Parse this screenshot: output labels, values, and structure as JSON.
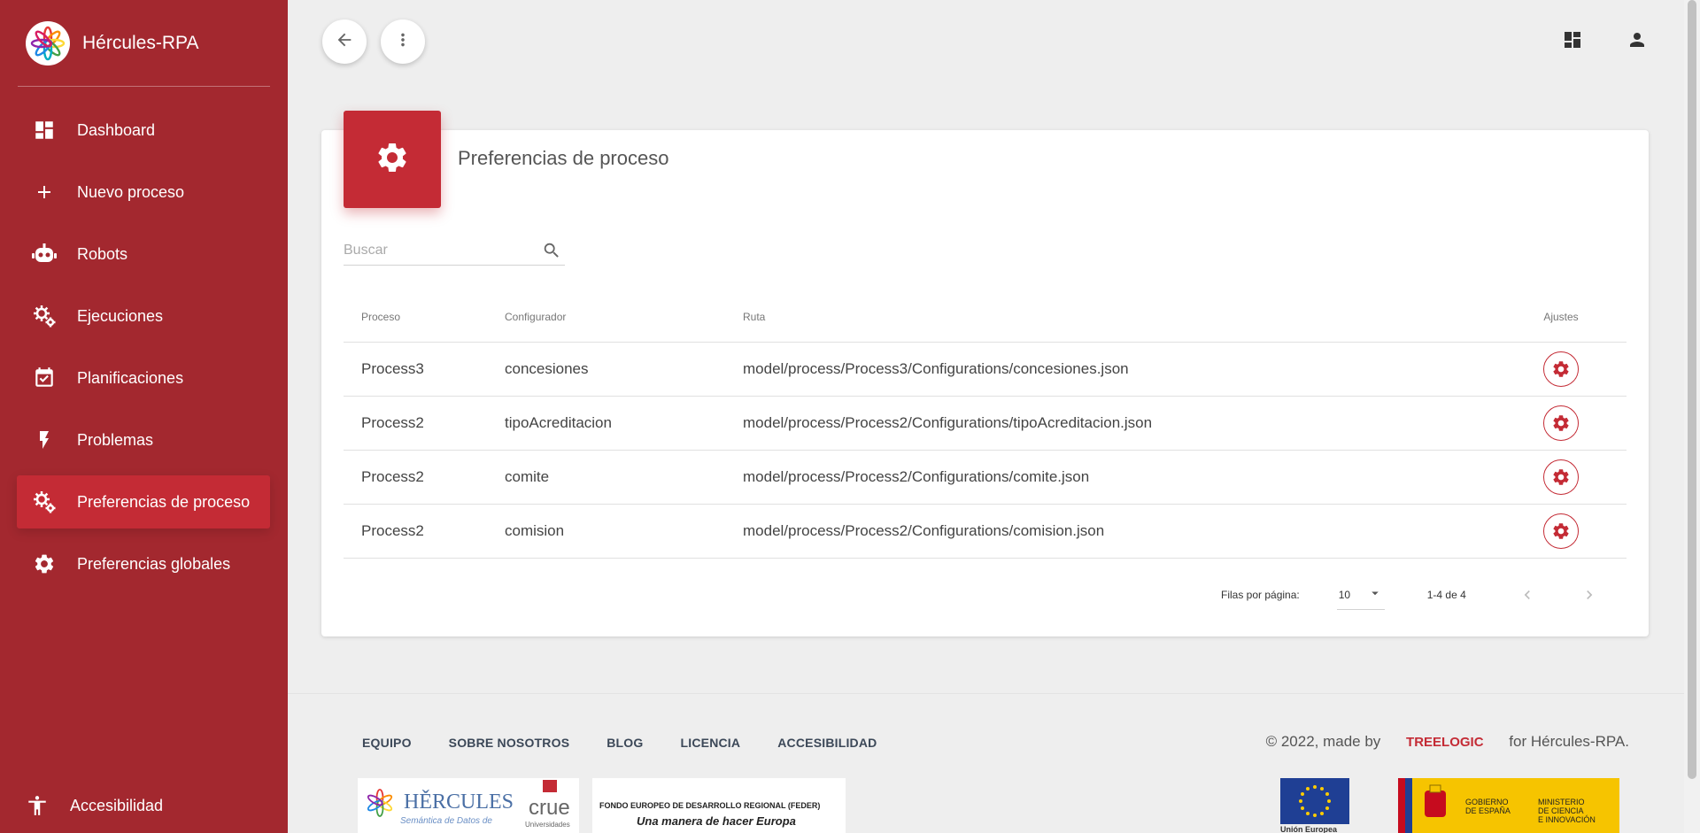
{
  "app": {
    "name": "Hércules-RPA"
  },
  "sidebar": {
    "items": [
      {
        "label": "Dashboard",
        "icon": "dashboard-icon"
      },
      {
        "label": "Nuevo proceso",
        "icon": "plus-icon"
      },
      {
        "label": "Robots",
        "icon": "robot-icon"
      },
      {
        "label": "Ejecuciones",
        "icon": "gears-icon"
      },
      {
        "label": "Planificaciones",
        "icon": "calendar-icon"
      },
      {
        "label": "Problemas",
        "icon": "bolt-icon"
      },
      {
        "label": "Preferencias de proceso",
        "icon": "gears-icon",
        "active": true
      },
      {
        "label": "Preferencias globales",
        "icon": "gear-icon"
      }
    ],
    "accessibility_label": "Accesibilidad"
  },
  "page": {
    "title": "Preferencias de proceso",
    "search_placeholder": "Buscar"
  },
  "table": {
    "headers": [
      "Proceso",
      "Configurador",
      "Ruta",
      "Ajustes"
    ],
    "rows": [
      {
        "proceso": "Process3",
        "configurador": "concesiones",
        "ruta": "model/process/Process3/Configurations/concesiones.json"
      },
      {
        "proceso": "Process2",
        "configurador": "tipoAcreditacion",
        "ruta": "model/process/Process2/Configurations/tipoAcreditacion.json"
      },
      {
        "proceso": "Process2",
        "configurador": "comite",
        "ruta": "model/process/Process2/Configurations/comite.json"
      },
      {
        "proceso": "Process2",
        "configurador": "comision",
        "ruta": "model/process/Process2/Configurations/comision.json"
      }
    ]
  },
  "pagination": {
    "rows_label": "Filas por página:",
    "rows_value": "10",
    "range": "1-4 de 4"
  },
  "footer": {
    "links": [
      "EQUIPO",
      "SOBRE NOSOTROS",
      "BLOG",
      "LICENCIA",
      "ACCESIBILIDAD"
    ],
    "copyright_prefix": "© 2022, made by",
    "company": "TREELOGIC",
    "copyright_suffix": "for Hércules-RPA.",
    "hercules_logo": "HĚRCULES",
    "hercules_sub": "Semántica de Datos de",
    "crue_logo": "crue",
    "crue_sub": "Universidades",
    "feder_title": "FONDO EUROPEO DE DESARROLLO REGIONAL (FEDER)",
    "feder_motto": "Una manera de hacer Europa",
    "eu_label": "Unión Europea",
    "gov_label_1": "GOBIERNO\nDE ESPAÑA",
    "gov_label_2": "MINISTERIO\nDE CIENCIA\nE INNOVACIÓN"
  },
  "colors": {
    "primary": "#a3282f",
    "accent": "#c42b35"
  }
}
